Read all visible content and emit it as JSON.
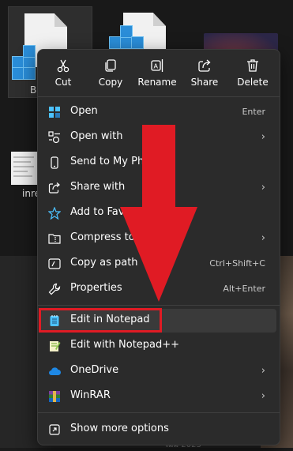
{
  "background": {
    "files": [
      {
        "label": "B"
      },
      {
        "label": "inre"
      }
    ],
    "partial_text": "ไม่มี 2023"
  },
  "quick_actions": [
    {
      "label": "Cut",
      "icon": "cut-icon"
    },
    {
      "label": "Copy",
      "icon": "copy-icon"
    },
    {
      "label": "Rename",
      "icon": "rename-icon"
    },
    {
      "label": "Share",
      "icon": "share-icon"
    },
    {
      "label": "Delete",
      "icon": "delete-icon"
    }
  ],
  "menu": {
    "open": {
      "label": "Open",
      "shortcut": "Enter"
    },
    "open_with": {
      "label": "Open with"
    },
    "send_to_phone": {
      "label": "Send to My Pho"
    },
    "share_with": {
      "label": "Share with"
    },
    "add_to_favorites": {
      "label": "Add to Favo"
    },
    "compress": {
      "label": "Compress to..."
    },
    "copy_as_path": {
      "label": "Copy as path",
      "shortcut": "Ctrl+Shift+C"
    },
    "properties": {
      "label": "Properties",
      "shortcut": "Alt+Enter"
    },
    "edit_notepad": {
      "label": "Edit in Notepad"
    },
    "edit_notepadpp": {
      "label": "Edit with Notepad++"
    },
    "onedrive": {
      "label": "OneDrive"
    },
    "winrar": {
      "label": "WinRAR"
    },
    "more_options": {
      "label": "Show more options"
    }
  },
  "colors": {
    "accent": "#4cc2ff",
    "annotation_red": "#e01b24",
    "menu_bg": "#2b2b2b"
  }
}
